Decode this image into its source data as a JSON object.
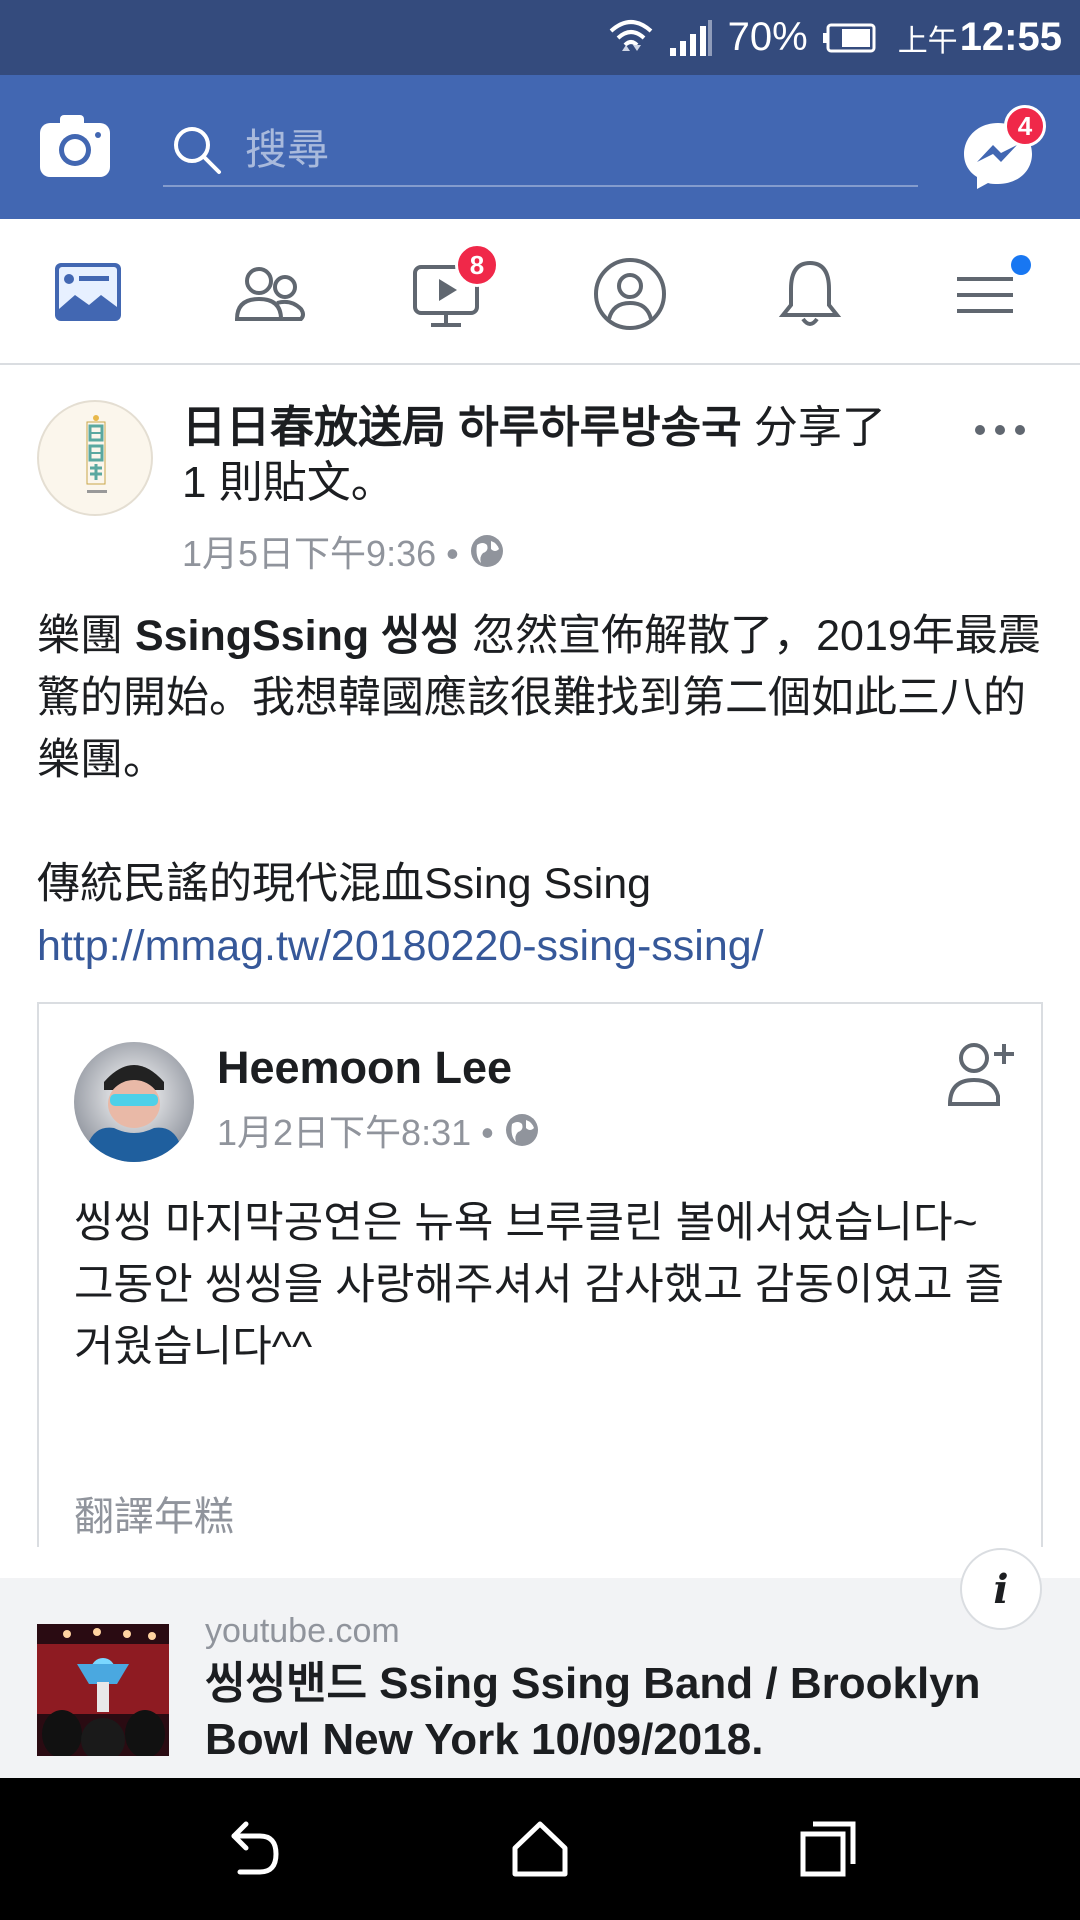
{
  "status_bar": {
    "battery_percent": "70%",
    "ampm": "上午",
    "time": "12:55"
  },
  "top_bar": {
    "search_placeholder": "搜尋",
    "messenger_badge": "4"
  },
  "nav": {
    "video_badge": "8",
    "menu_dot_color": "#1877f2"
  },
  "post": {
    "page_name": "日日春放送局 하루하루방송국",
    "action_text": " 分享了 1 則貼文。",
    "timestamp": "1月5日下午9:36 • ",
    "body": {
      "p1_prefix": "樂團 ",
      "p1_bold": "SsingSsing 씽씽",
      "p1_suffix": " 忽然宣佈解散了，2019年最震驚的開始。我想韓國應該很難找到第二個如此三八的樂團。",
      "p2": "傳統民謠的現代混血Ssing Ssing",
      "link": "http://mmag.tw/20180220-ssing-ssing/"
    }
  },
  "shared_post": {
    "author": "Heemoon Lee",
    "timestamp": "1月2日下午8:31 • ",
    "line1": "씽씽 마지막공연은 뉴욕 브루클린 볼에서였습니다~",
    "line2": "그동안 씽씽을 사랑해주셔서 감사했고 감동이였고 즐거웠습니다^^",
    "translate": "翻譯年糕"
  },
  "link_preview": {
    "source": "youtube.com",
    "title": "씽씽밴드 Ssing Ssing Band / Brooklyn Bowl New York 10/09/2018."
  },
  "colors": {
    "facebook_blue": "#4267b2",
    "status_bar": "#344b7d",
    "badge_red": "#f02849",
    "link_blue": "#365899"
  }
}
